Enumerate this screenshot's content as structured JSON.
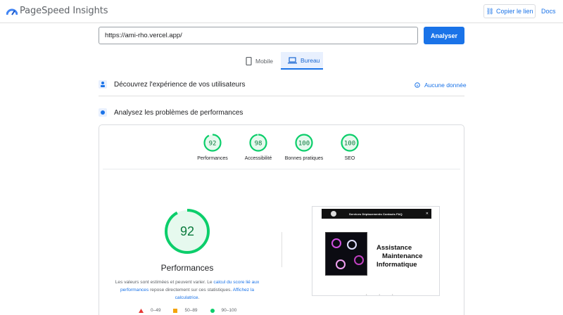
{
  "header": {
    "brand": "PageSpeed Insights",
    "copy_link": "Copier le lien",
    "docs": "Docs"
  },
  "search": {
    "url_value": "https://ami-rho.vercel.app/",
    "analyze_label": "Analyser"
  },
  "tabs": [
    {
      "label": "Mobile",
      "icon": "smartphone-icon",
      "selected": false
    },
    {
      "label": "Bureau",
      "icon": "laptop-icon",
      "selected": true
    }
  ],
  "sections": {
    "field_title": "Découvrez l'expérience de vos utilisateurs",
    "field_status": "Aucune donnée",
    "lab_title": "Analysez les problèmes de performances"
  },
  "scores": [
    {
      "label": "Performances",
      "value": "92",
      "fraction": 0.92
    },
    {
      "label": "Accessibilité",
      "value": "98",
      "fraction": 0.98
    },
    {
      "label": "Bonnes pratiques",
      "value": "100",
      "fraction": 1.0
    },
    {
      "label": "SEO",
      "value": "100",
      "fraction": 1.0
    }
  ],
  "main_score": {
    "value": "92",
    "fraction": 0.92,
    "title": "Performances",
    "note_part1": "Les valeurs sont estimées et peuvent varier. Le ",
    "note_link1": "calcul du score lié aux performances",
    "note_part2": " repose directement sur ces statistiques. ",
    "note_link2": "Affichez la calculatrice",
    "note_end": "."
  },
  "legend": [
    {
      "range": "0–49",
      "color": "#e53935"
    },
    {
      "range": "50–89",
      "color": "#f4a30a"
    },
    {
      "range": "90–100",
      "color": "#0cce6b"
    }
  ],
  "screenshot": {
    "nav_links": "Services  Déplacements  Contacts  FAQ",
    "nav_close": "✕",
    "line1": "Assistance",
    "line2": "Maintenance",
    "line3": "Informatique",
    "dots": "• • •"
  },
  "colors": {
    "accent": "#1a73e8",
    "good": "#0cce6b",
    "good_text": "#0a7a3c",
    "good_bg": "#e6f9ee"
  }
}
